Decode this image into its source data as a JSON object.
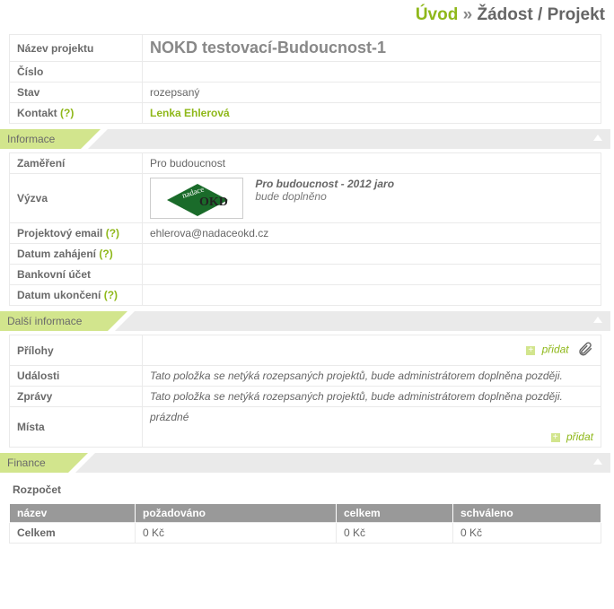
{
  "breadcrumb": {
    "home": "Úvod",
    "sep": "»",
    "current": "Žádost / Projekt"
  },
  "project": {
    "label_name": "Název projektu",
    "name": "NOKD testovací-Budoucnost-1",
    "label_number": "Číslo",
    "number": "",
    "label_state": "Stav",
    "state": "rozepsaný",
    "label_contact": "Kontakt",
    "contact_q": "(?)",
    "contact": "Lenka Ehlerová"
  },
  "section_info": {
    "title": "Informace"
  },
  "info": {
    "label_zamereni": "Zaměření",
    "zamereni": "Pro budoucnost",
    "label_vyzva": "Výzva",
    "vyzva_title": "Pro budoucnost - 2012 jaro",
    "vyzva_sub": "bude doplněno",
    "logo_text1": "nadace",
    "logo_text2": "OKD",
    "label_email": "Projektový email",
    "email_q": "(?)",
    "email": "ehlerova@nadaceokd.cz",
    "label_start": "Datum zahájení",
    "start_q": "(?)",
    "start": "",
    "label_bank": "Bankovní účet",
    "bank": "",
    "label_end": "Datum ukončení",
    "end_q": "(?)",
    "end": ""
  },
  "section_dalsi": {
    "title": "Další informace"
  },
  "dalsi": {
    "label_prilohy": "Přílohy",
    "add": "přidat",
    "label_udalosti": "Události",
    "msg_udalosti": "Tato položka se netýká rozepsaných projektů, bude administrátorem doplněna později.",
    "label_zpravy": "Zprávy",
    "msg_zpravy": "Tato položka se netýká rozepsaných projektů, bude administrátorem doplněna později.",
    "label_mista": "Místa",
    "mista_val": "prázdné"
  },
  "section_finance": {
    "title": "Finance"
  },
  "finance": {
    "subhead": "Rozpočet",
    "col_name": "název",
    "col_req": "požadováno",
    "col_total": "celkem",
    "col_approved": "schváleno",
    "row_label": "Celkem",
    "row_req": "0 Kč",
    "row_total": "0 Kč",
    "row_approved": "0 Kč"
  }
}
